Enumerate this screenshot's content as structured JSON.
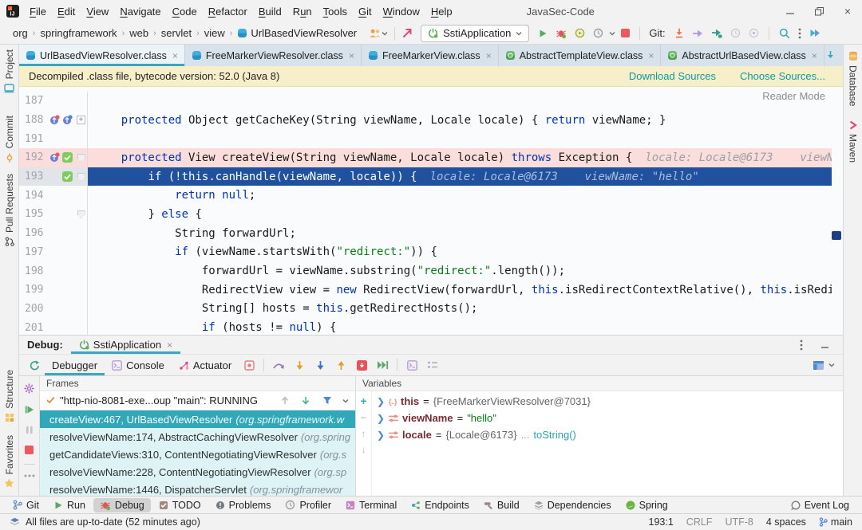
{
  "window": {
    "title": "JavaSec-Code"
  },
  "menu": {
    "items": [
      {
        "label": "File",
        "u": 0
      },
      {
        "label": "Edit",
        "u": 0
      },
      {
        "label": "View",
        "u": 0
      },
      {
        "label": "Navigate",
        "u": 0
      },
      {
        "label": "Code",
        "u": 0
      },
      {
        "label": "Refactor",
        "u": 0
      },
      {
        "label": "Build",
        "u": 0
      },
      {
        "label": "Run",
        "u": 1
      },
      {
        "label": "Tools",
        "u": 0
      },
      {
        "label": "Git",
        "u": 0
      },
      {
        "label": "Window",
        "u": 0
      },
      {
        "label": "Help",
        "u": 0
      }
    ]
  },
  "navbar": {
    "breadcrumbs": [
      "org",
      "springframework",
      "web",
      "servlet",
      "view"
    ],
    "class_name": "UrlBasedViewResolver",
    "run_config": "SstiApplication",
    "git_label": "Git:"
  },
  "editor_tabs": [
    {
      "label": "UrlBasedViewResolver.class",
      "icon": "class-blue",
      "active": true
    },
    {
      "label": "FreeMarkerViewResolver.class",
      "icon": "class-blue",
      "active": false
    },
    {
      "label": "FreeMarkerView.class",
      "icon": "class-blue",
      "active": false
    },
    {
      "label": "AbstractTemplateView.class",
      "icon": "class-green",
      "active": false
    },
    {
      "label": "AbstractUrlBasedView.class",
      "icon": "class-green",
      "active": false
    }
  ],
  "banner": {
    "text": "Decompiled .class file, bytecode version: 52.0 (Java 8)",
    "links": [
      "Download Sources",
      "Choose Sources..."
    ]
  },
  "editor": {
    "reader_mode_label": "Reader Mode",
    "lines": [
      {
        "num": "187",
        "indent": 0,
        "gutter": [],
        "fold": "",
        "hl": "",
        "tokens": []
      },
      {
        "num": "188",
        "indent": 4,
        "gutter": [
          "ov",
          "ov2"
        ],
        "fold": "+",
        "hl": "",
        "tokens": [
          [
            "kw",
            "protected"
          ],
          [
            "pl",
            " Object getCacheKey(String viewName, Locale locale) { "
          ],
          [
            "kw",
            "return"
          ],
          [
            "pl",
            " viewName; }"
          ]
        ]
      },
      {
        "num": "191",
        "indent": 0,
        "gutter": [],
        "fold": "",
        "hl": "",
        "tokens": []
      },
      {
        "num": "192",
        "indent": 4,
        "gutter": [
          "ov",
          "bp"
        ],
        "fold": "v",
        "hl": "pink",
        "tokens": [
          [
            "kw",
            "protected"
          ],
          [
            "pl",
            " View createView(String viewName, Locale locale) "
          ],
          [
            "kw",
            "throws"
          ],
          [
            "pl",
            " Exception {"
          ],
          [
            "hint",
            "locale: Locale@6173    viewN"
          ]
        ]
      },
      {
        "num": "193",
        "indent": 8,
        "gutter": [
          "sp",
          "bp"
        ],
        "fold": "v",
        "hl": "blue",
        "tokens": [
          [
            "kw",
            "if"
          ],
          [
            "pl",
            " (!"
          ],
          [
            "kw",
            "this"
          ],
          [
            "pl",
            ".canHandle(viewName, locale)) {"
          ],
          [
            "hint",
            "locale: Locale@6173    viewName: \"hello\""
          ]
        ]
      },
      {
        "num": "194",
        "indent": 12,
        "gutter": [],
        "fold": "",
        "hl": "",
        "tokens": [
          [
            "kw",
            "return null"
          ],
          [
            "pl",
            ";"
          ]
        ]
      },
      {
        "num": "195",
        "indent": 8,
        "gutter": [],
        "fold": "v",
        "hl": "",
        "tokens": [
          [
            "pl",
            "} "
          ],
          [
            "kw",
            "else"
          ],
          [
            "pl",
            " {"
          ]
        ]
      },
      {
        "num": "196",
        "indent": 12,
        "gutter": [],
        "fold": "",
        "hl": "",
        "tokens": [
          [
            "pl",
            "String forwardUrl;"
          ]
        ]
      },
      {
        "num": "197",
        "indent": 12,
        "gutter": [],
        "fold": "",
        "hl": "",
        "tokens": [
          [
            "kw",
            "if"
          ],
          [
            "pl",
            " (viewName.startsWith("
          ],
          [
            "str",
            "\"redirect:\""
          ],
          [
            "pl",
            ")) {"
          ]
        ]
      },
      {
        "num": "198",
        "indent": 16,
        "gutter": [],
        "fold": "",
        "hl": "",
        "tokens": [
          [
            "pl",
            "forwardUrl = viewName.substring("
          ],
          [
            "str",
            "\"redirect:\""
          ],
          [
            "pl",
            ".length());"
          ]
        ]
      },
      {
        "num": "199",
        "indent": 16,
        "gutter": [],
        "fold": "",
        "hl": "",
        "tokens": [
          [
            "pl",
            "RedirectView view = "
          ],
          [
            "kw",
            "new"
          ],
          [
            "pl",
            " RedirectView(forwardUrl, "
          ],
          [
            "kw",
            "this"
          ],
          [
            "pl",
            ".isRedirectContextRelative(), "
          ],
          [
            "kw",
            "this"
          ],
          [
            "pl",
            ".isRedi"
          ]
        ]
      },
      {
        "num": "200",
        "indent": 16,
        "gutter": [],
        "fold": "",
        "hl": "",
        "tokens": [
          [
            "pl",
            "String[] hosts = "
          ],
          [
            "kw",
            "this"
          ],
          [
            "pl",
            ".getRedirectHosts();"
          ]
        ]
      },
      {
        "num": "201",
        "indent": 16,
        "gutter": [],
        "fold": "",
        "hl": "",
        "tokens": [
          [
            "kw",
            "if"
          ],
          [
            "pl",
            " (hosts != "
          ],
          [
            "kw",
            "null"
          ],
          [
            "pl",
            ") {"
          ]
        ]
      }
    ]
  },
  "debug": {
    "label": "Debug:",
    "session_tab": "SstiApplication",
    "tabs": [
      {
        "label": "Debugger",
        "icon": "",
        "active": true
      },
      {
        "label": "Console",
        "icon": "console-purple",
        "active": false
      },
      {
        "label": "Actuator",
        "icon": "actuator-pink",
        "active": false
      }
    ],
    "frames": {
      "title": "Frames",
      "thread": "\"http-nio-8081-exe...oup \"main\": RUNNING",
      "items": [
        {
          "text": "createView:467, UrlBasedViewResolver",
          "pkg": "(org.springframework.w",
          "selected": true
        },
        {
          "text": "resolveViewName:174, AbstractCachingViewResolver",
          "pkg": "(org.spring",
          "selected": false
        },
        {
          "text": "getCandidateViews:310, ContentNegotiatingViewResolver",
          "pkg": "(org.s",
          "selected": false
        },
        {
          "text": "resolveViewName:228, ContentNegotiatingViewResolver",
          "pkg": "(org.sp",
          "selected": false
        },
        {
          "text": "resolveViewName:1446, DispatcherServlet",
          "pkg": "(org.springframewor",
          "selected": false
        }
      ]
    },
    "variables": {
      "title": "Variables",
      "items": [
        {
          "icon": "braces",
          "name": "this",
          "eq": " = ",
          "value": "{FreeMarkerViewResolver@7031}",
          "vtype": "ref",
          "extra": "",
          "link": ""
        },
        {
          "icon": "param",
          "name": "viewName",
          "eq": " = ",
          "value": "\"hello\"",
          "vtype": "string",
          "extra": "",
          "link": ""
        },
        {
          "icon": "param",
          "name": "locale",
          "eq": " = ",
          "value": "{Locale@6173}",
          "vtype": "ref",
          "extra": " ... ",
          "link": "toString()"
        }
      ]
    }
  },
  "left_strip": {
    "top": [
      {
        "label": "Project",
        "icon": "project"
      },
      {
        "label": "Commit",
        "icon": "commit"
      },
      {
        "label": "Pull Requests",
        "icon": "pull-requests"
      }
    ],
    "bottom": [
      {
        "label": "Structure",
        "icon": "structure"
      },
      {
        "label": "Favorites",
        "icon": "favorites"
      }
    ]
  },
  "right_strip": [
    {
      "label": "Database",
      "icon": "database"
    },
    {
      "label": "Maven",
      "icon": "maven"
    }
  ],
  "bottom_bar": {
    "items": [
      {
        "label": "Git",
        "icon": "git-branch"
      },
      {
        "label": "Run",
        "icon": "play-green"
      },
      {
        "label": "Debug",
        "icon": "bug-red",
        "active": true
      },
      {
        "label": "TODO",
        "icon": "todo"
      },
      {
        "label": "Problems",
        "icon": "problems"
      },
      {
        "label": "Profiler",
        "icon": "clock-gray"
      },
      {
        "label": "Terminal",
        "icon": "terminal"
      },
      {
        "label": "Endpoints",
        "icon": "endpoints"
      },
      {
        "label": "Build",
        "icon": "build"
      },
      {
        "label": "Dependencies",
        "icon": "dependencies"
      },
      {
        "label": "Spring",
        "icon": "spring"
      }
    ],
    "right": {
      "label": "Event Log",
      "icon": "event-log"
    }
  },
  "status_bar": {
    "left": "All files are up-to-date (52 minutes ago)",
    "position": "193:1",
    "line_ending": "CRLF",
    "encoding": "UTF-8",
    "indent": "4 spaces",
    "branch": "main"
  },
  "colors": {
    "accent_teal": "#39a7c4",
    "exec_line_blue": "#20519f",
    "breakpoint_line_pink": "#fbdddb",
    "selected_frame_teal": "#31a8b9",
    "banner_yellow": "#f6efca"
  }
}
